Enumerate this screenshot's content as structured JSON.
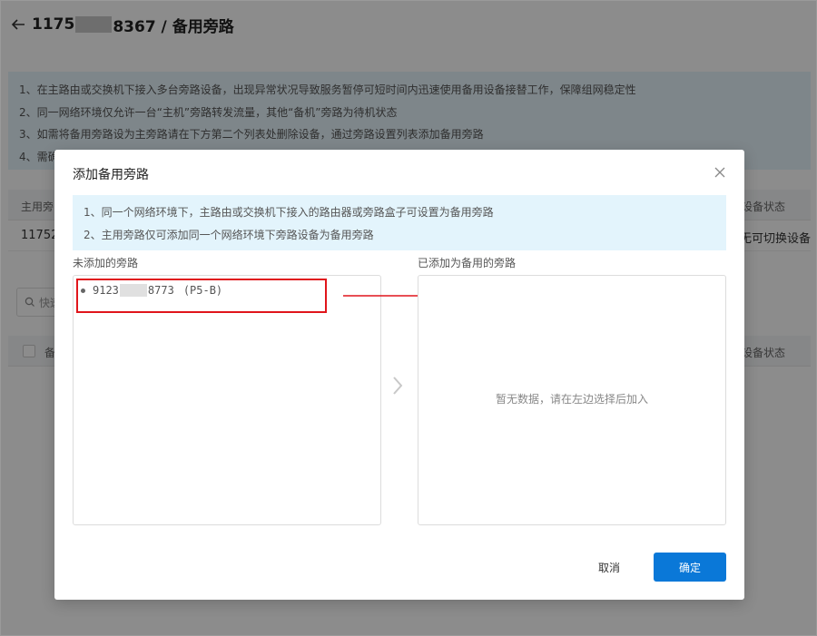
{
  "page": {
    "title_prefix": "1175",
    "title_suffix": "8367 / 备用旁路"
  },
  "notice": {
    "lines": [
      "1、在主路由或交换机下接入多台旁路设备，出现异常状况导致服务暂停可短时间内迅速使用备用设备接替工作，保障组网稳定性",
      "2、同一网络环境仅允许一台“主机”旁路转发流量，其他“备机”旁路为待机状态",
      "3、如需将备用旁路设为主旁路请在下方第二个列表处删除设备，通过旁路设置列表添加备用旁路",
      "4、需确"
    ]
  },
  "table1": {
    "col_main": "主用旁",
    "col_status": "设备状态",
    "row_id": "11752",
    "row_status": "无可切换设备"
  },
  "search": {
    "placeholder": "快速"
  },
  "table2": {
    "col_backup": "备",
    "col_status": "设备状态"
  },
  "modal": {
    "title": "添加备用旁路",
    "info": [
      "1、同一个网络环境下，主路由或交换机下接入的路由器或旁路盒子可设置为备用旁路",
      "2、主用旁路仅可添加同一个网络环境下旁路设备为备用旁路"
    ],
    "left_label": "未添加的旁路",
    "right_label": "已添加为备用的旁路",
    "item": {
      "id_prefix": "9123",
      "id_suffix": "8773",
      "model": "(P5-B)"
    },
    "empty_text": "暂无数据，请在左边选择后加入",
    "cancel": "取消",
    "confirm": "确定"
  },
  "colors": {
    "accent": "#0a78d8",
    "highlight": "#e0151b",
    "info_bg": "#e3f4fc"
  }
}
